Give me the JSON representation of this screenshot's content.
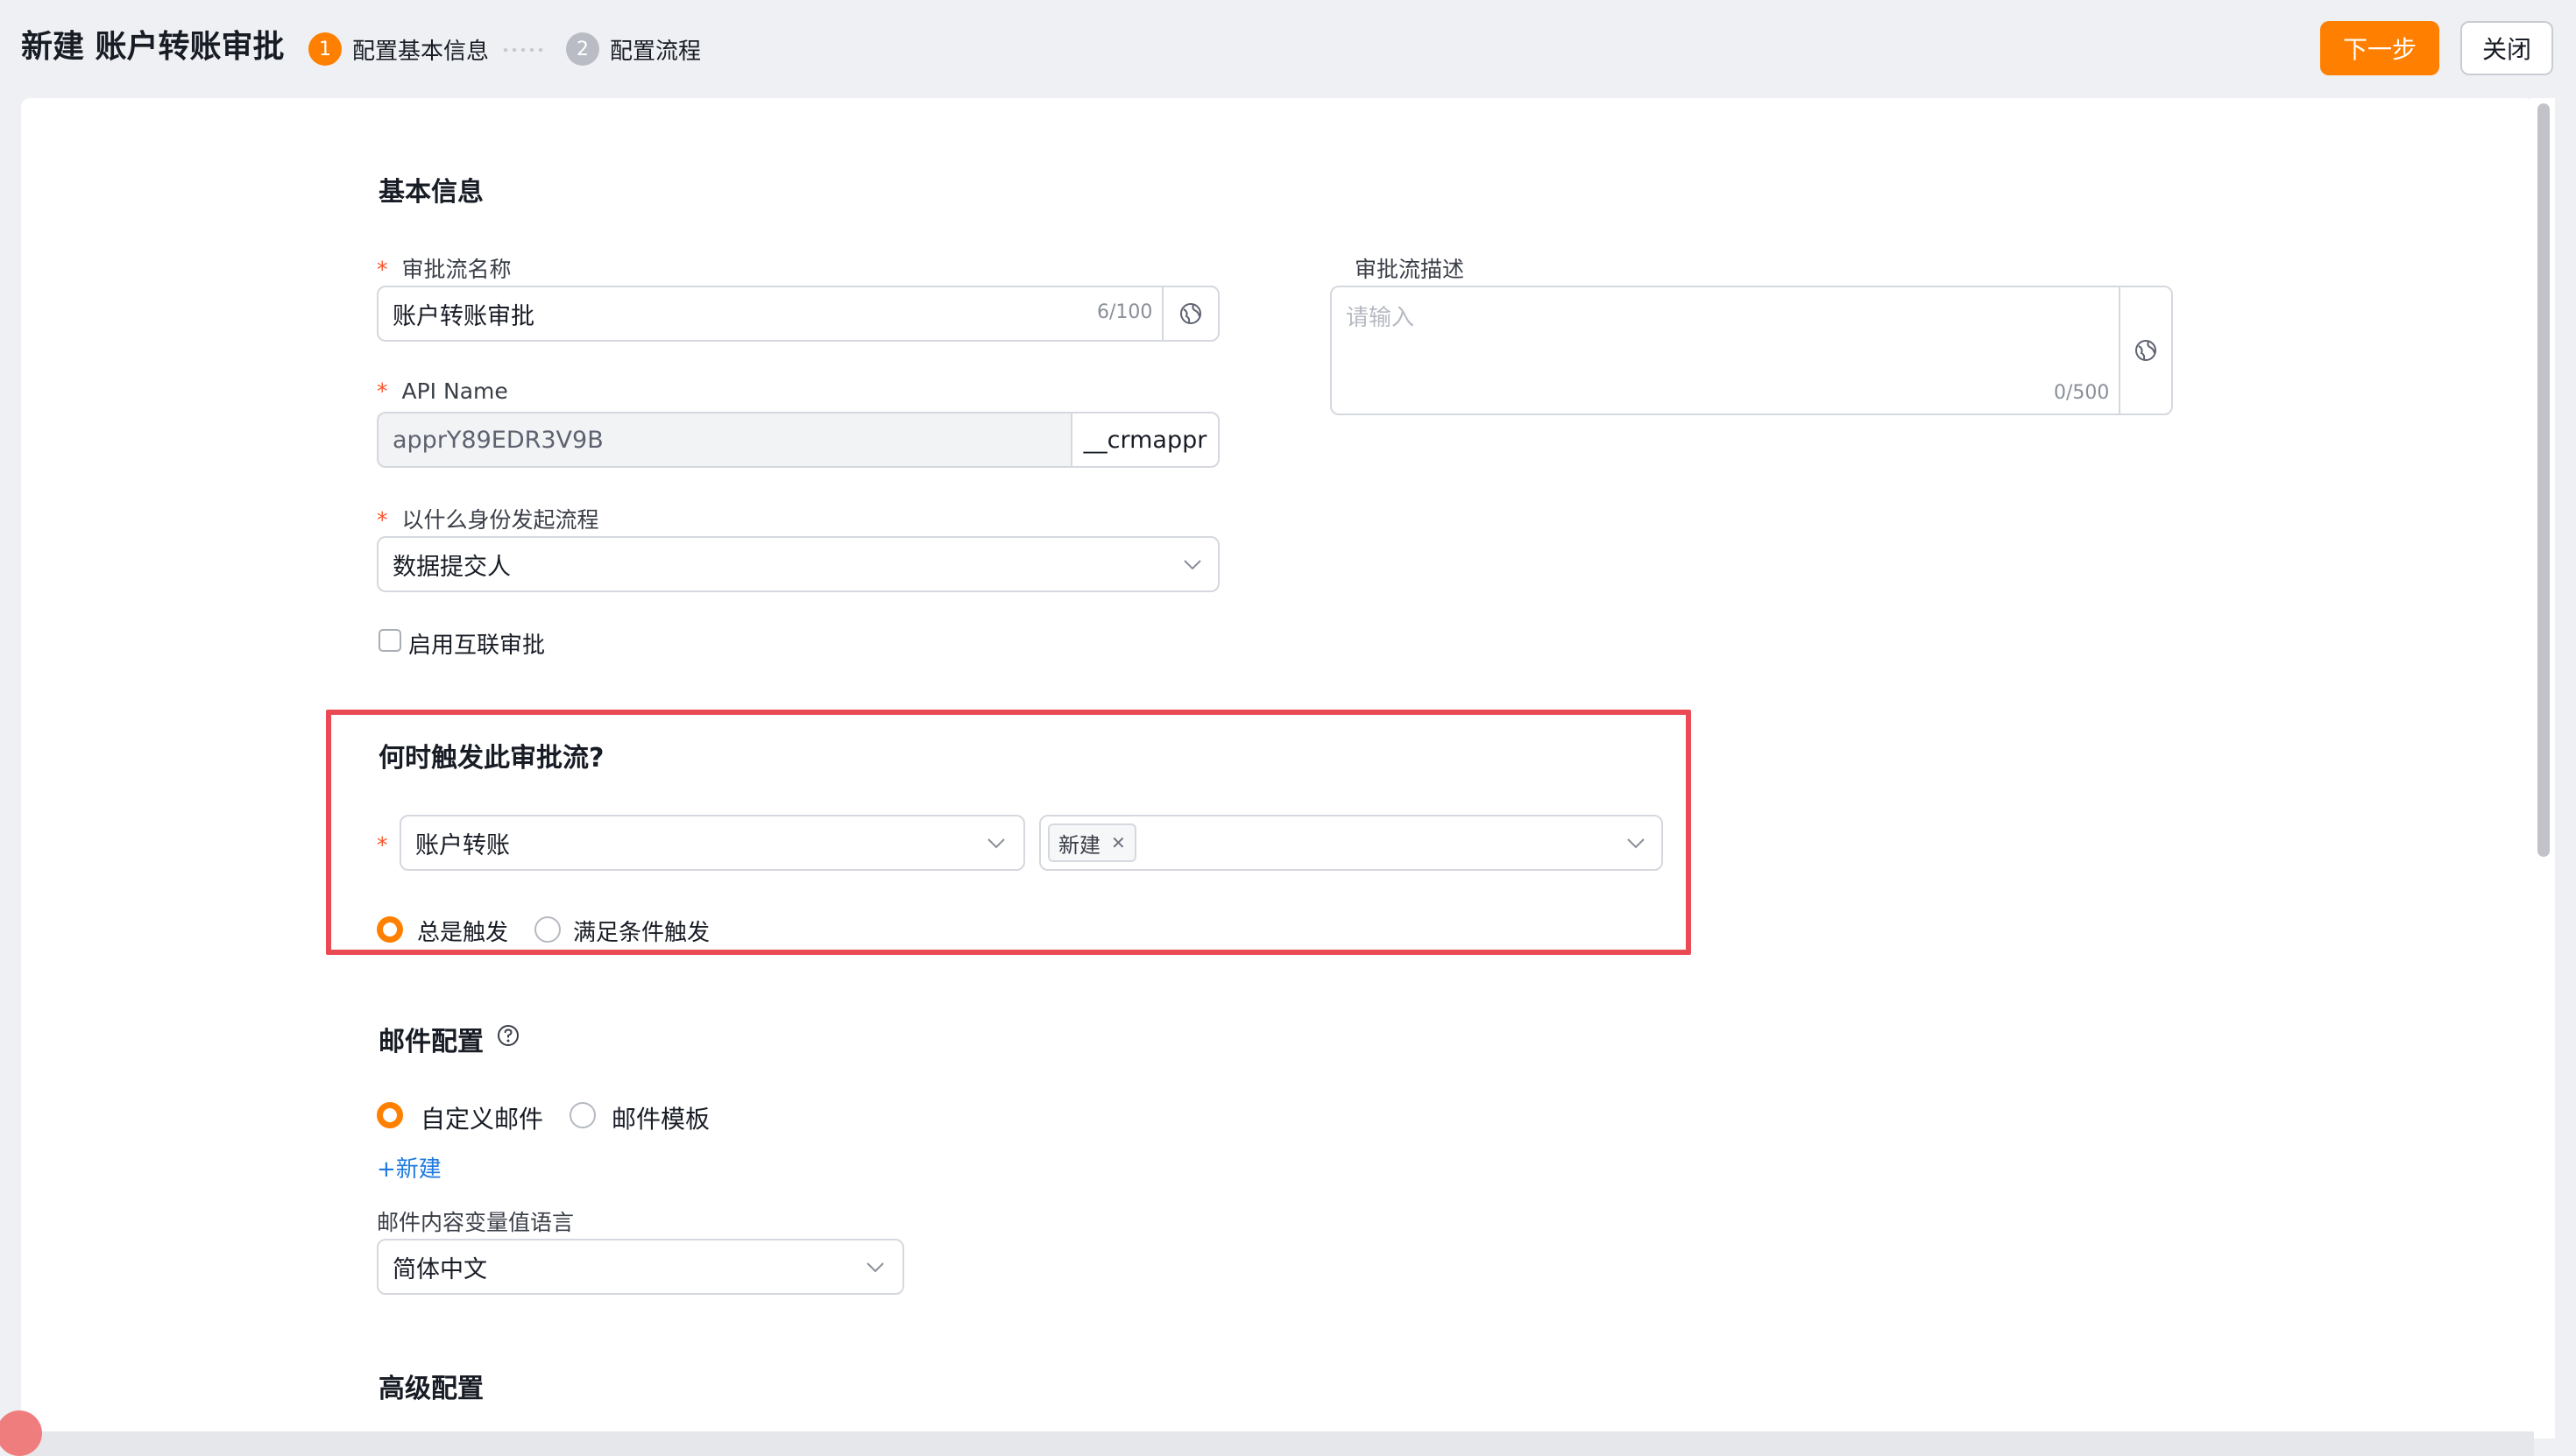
{
  "header": {
    "title": "新建 账户转账审批",
    "steps": [
      {
        "num": "1",
        "label": "配置基本信息"
      },
      {
        "num": "2",
        "label": "配置流程"
      }
    ],
    "next_label": "下一步",
    "close_label": "关闭"
  },
  "basic": {
    "title": "基本信息",
    "name_label": "审批流名称",
    "name_value": "账户转账审批",
    "name_counter": "6/100",
    "desc_label": "审批流描述",
    "desc_placeholder": "请输入",
    "desc_counter": "0/500",
    "api_label": "API Name",
    "api_value": "apprY89EDR3V9B",
    "api_suffix": "__crmappr",
    "identity_label": "以什么身份发起流程",
    "identity_value": "数据提交人",
    "interconnect_label": "启用互联审批"
  },
  "trigger": {
    "title": "何时触发此审批流?",
    "object_value": "账户转账",
    "event_tag": "新建",
    "radios": [
      "总是触发",
      "满足条件触发"
    ]
  },
  "email": {
    "title": "邮件配置",
    "radios": [
      "自定义邮件",
      "邮件模板"
    ],
    "new_link": "+新建",
    "lang_label": "邮件内容变量值语言",
    "lang_value": "简体中文"
  },
  "advanced": {
    "title": "高级配置"
  },
  "colors": {
    "accent": "#ff8000",
    "highlight": "#ea4a54",
    "link": "#1f7ae0",
    "required": "#ff522a"
  }
}
